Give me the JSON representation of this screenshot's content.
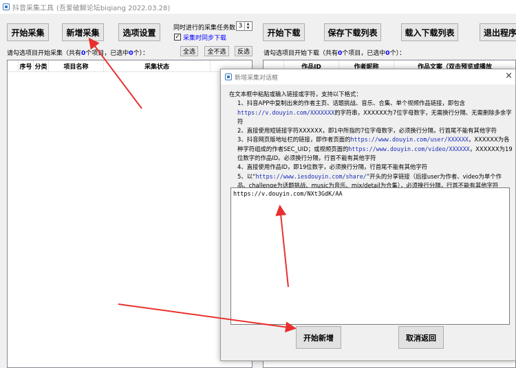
{
  "window": {
    "title": "抖音采集工具",
    "title_suffix": "(吾爱破解论坛biqiang 2022.03.28)"
  },
  "toolbar_left": {
    "start": "开始采集",
    "add": "新增采集",
    "options": "选项设置",
    "concurrent_label": "同时进行的采集任务数",
    "concurrent_value": "3",
    "sync_download_label": "采集时同步下载",
    "sync_download_checked": true
  },
  "left_panel": {
    "hint_prefix": "请勾选项目开始采集（共有",
    "total": "0",
    "hint_mid": "个项目，已选中",
    "selected": "0",
    "hint_suffix": "个）：",
    "select_all": "全选",
    "select_none": "全不选",
    "invert": "反选",
    "columns": [
      "序号",
      "分类",
      "项目名称",
      "采集状态"
    ]
  },
  "toolbar_right": {
    "start_download": "开始下载",
    "save_list": "保存下载列表",
    "load_list": "载入下载列表",
    "exit": "退出程序"
  },
  "right_panel": {
    "hint_prefix": "请勾选项目开始下载（共有",
    "total": "0",
    "hint_mid": "个项目，已选中",
    "selected": "0",
    "hint_suffix": "个）：",
    "columns": [
      "作品ID",
      "作者昵称",
      "作品文案（双击预览或播放"
    ]
  },
  "dialog": {
    "title": "新增采集对话框",
    "intro": "在文本框中粘贴或输入链接或字符，支持以下格式：",
    "items": [
      {
        "n": "1、",
        "a": "抖音APP中复制出来的作者主页、话题挑战、音乐、合集、单个视频作品链接，即包含",
        "link": "https://v.douyin.com/XXXXXXX",
        "b": "的字符串，XXXXXX为7位字母数字，无需换行分隔、无需删除多余字符"
      },
      {
        "n": "2、",
        "a": "直接使用短链接字符XXXXXX，即1中所指的7位字母数字，必须换行分隔，行首尾不能有其他字符",
        "link": "",
        "b": ""
      },
      {
        "n": "3、",
        "a": "抖音网页版地址栏的链接，即作者页面的",
        "link": "https://www.douyin.com/user/XXXXXX",
        "b": "，XXXXXX为各种字符组成的作者SEC_UID；或视频页面的",
        "link2": "https://www.douyin.com/video/XXXXXX",
        "c": "，XXXXXX为19位数字的作品ID。必须换行分隔，行首不能有其他字符"
      },
      {
        "n": "4、",
        "a": "直接使用作品ID，即19位数字，必须换行分隔，行首尾不能有其他字符",
        "link": "",
        "b": ""
      },
      {
        "n": "5、",
        "a": "以“",
        "link": "https://www.iesdouyin.com/share/",
        "b": "”开头的分享链接（后接user为作者、video为单个作品、challenge为话题挑战、music为音乐、mix/detail为合集），必须换行分隔，行首不能有其他字符"
      }
    ],
    "input_value": "https://v.douyin.com/NXt3GdK/AA",
    "confirm": "开始新增",
    "cancel": "取消返回",
    "close_glyph": "×"
  },
  "colors": {
    "annotation_arrow": "#e8312f",
    "link": "#1a2db8",
    "count": "#0000ff"
  }
}
